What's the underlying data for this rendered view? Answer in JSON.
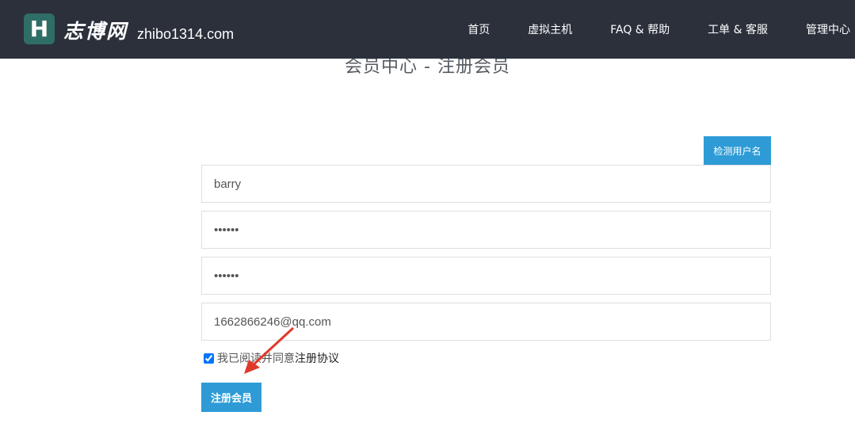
{
  "header": {
    "logo_letter": "H",
    "brand_name": "志博网",
    "domain": "zhibo1314.com",
    "nav": [
      "首页",
      "虚拟主机",
      "FAQ & 帮助",
      "工单 & 客服",
      "管理中心"
    ]
  },
  "page_title": "会员中心 - 注册会员",
  "form": {
    "check_button": "检测用户名",
    "username": "barry",
    "password": "••••••",
    "password_confirm": "••••••",
    "email": "1662866246@qq.com",
    "agree_checked": true,
    "agree_text": "我已阅读并同意",
    "agree_link": "注册协议",
    "submit": "注册会员"
  },
  "colors": {
    "navbar_bg": "#2b303b",
    "logo_bg": "#2f6e66",
    "accent": "#2e9bd6",
    "annotation_arrow": "#e0392b"
  }
}
